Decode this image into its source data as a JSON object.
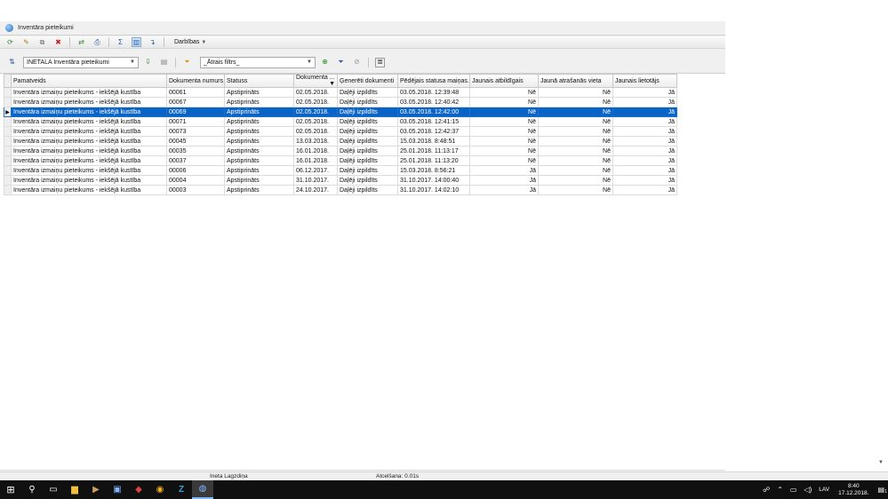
{
  "window": {
    "title": "Inventāra pieteikumi"
  },
  "toolbar": {
    "actions_menu": "Darbības",
    "buttons": [
      {
        "name": "new-icon",
        "glyph": "⟳",
        "color": "#2a8a2a"
      },
      {
        "name": "edit-icon",
        "glyph": "✎",
        "color": "#b07a10"
      },
      {
        "name": "copy-icon",
        "glyph": "⧉",
        "color": "#666666"
      },
      {
        "name": "delete-icon",
        "glyph": "✖",
        "color": "#c82020"
      },
      {
        "name": "refresh-icon",
        "glyph": "⇄",
        "color": "#2a8a2a"
      },
      {
        "name": "print-icon",
        "glyph": "⎙",
        "color": "#2a5aa0"
      },
      {
        "name": "sum-icon",
        "glyph": "Σ",
        "color": "#2a5aa0"
      },
      {
        "name": "columns-icon",
        "glyph": "▥",
        "color": "#2a5aa0"
      },
      {
        "name": "export-icon",
        "glyph": "↴",
        "color": "#2a5aa0"
      }
    ]
  },
  "filter": {
    "view_value": "INETALA Inventāra pieteikumi",
    "quick_filter_value": "_Ātrais filtrs_"
  },
  "grid": {
    "columns": [
      "Pamatveids",
      "Dokumenta numurs",
      "Statuss",
      "Dokumenta ...",
      "Ģenerēti dokumenti",
      "Pēdējais statusa maiņas...",
      "Jaunais atbildīgais",
      "Jaunā atrašanās vieta",
      "Jaunais lietotājs"
    ],
    "selected_index": 2,
    "rows": [
      [
        "Inventāra izmaiņu pieteikums - iekšējā kustība",
        "00061",
        "Apstiprināts",
        "02.05.2018.",
        "Daļēji izpildīts",
        "03.05.2018. 12:39:48",
        "Nē",
        "Nē",
        "Jā"
      ],
      [
        "Inventāra izmaiņu pieteikums - iekšējā kustība",
        "00067",
        "Apstiprināts",
        "02.05.2018.",
        "Daļēji izpildīts",
        "03.05.2018. 12:40:42",
        "Nē",
        "Nē",
        "Jā"
      ],
      [
        "Inventāra izmaiņu pieteikums - iekšējā kustība",
        "00069",
        "Apstiprināts",
        "02.05.2018.",
        "Daļēji izpildīts",
        "03.05.2018. 12:42:00",
        "Nē",
        "Nē",
        "Jā"
      ],
      [
        "Inventāra izmaiņu pieteikums - iekšējā kustība",
        "00071",
        "Apstiprināts",
        "02.05.2018.",
        "Daļēji izpildīts",
        "03.05.2018. 12:41:15",
        "Nē",
        "Nē",
        "Jā"
      ],
      [
        "Inventāra izmaiņu pieteikums - iekšējā kustība",
        "00073",
        "Apstiprināts",
        "02.05.2018.",
        "Daļēji izpildīts",
        "03.05.2018. 12:42:37",
        "Nē",
        "Nē",
        "Jā"
      ],
      [
        "Inventāra izmaiņu pieteikums - iekšējā kustība",
        "00045",
        "Apstiprināts",
        "13.03.2018.",
        "Daļēji izpildīts",
        "15.03.2018. 8:48:51",
        "Nē",
        "Nē",
        "Jā"
      ],
      [
        "Inventāra izmaiņu pieteikums - iekšējā kustība",
        "00035",
        "Apstiprināts",
        "16.01.2018.",
        "Daļēji izpildīts",
        "25.01.2018. 11:13:17",
        "Nē",
        "Nē",
        "Jā"
      ],
      [
        "Inventāra izmaiņu pieteikums - iekšējā kustība",
        "00037",
        "Apstiprināts",
        "16.01.2018.",
        "Daļēji izpildīts",
        "25.01.2018. 11:13:20",
        "Nē",
        "Nē",
        "Jā"
      ],
      [
        "Inventāra izmaiņu pieteikums - iekšējā kustība",
        "00006",
        "Apstiprināts",
        "06.12.2017.",
        "Daļēji izpildīts",
        "15.03.2018. 8:56:21",
        "Jā",
        "Nē",
        "Jā"
      ],
      [
        "Inventāra izmaiņu pieteikums - iekšējā kustība",
        "00004",
        "Apstiprināts",
        "31.10.2017.",
        "Daļēji izpildīts",
        "31.10.2017. 14:00:40",
        "Jā",
        "Nē",
        "Jā"
      ],
      [
        "Inventāra izmaiņu pieteikums - iekšējā kustība",
        "00003",
        "Apstiprināts",
        "24.10.2017.",
        "Daļēji izpildīts",
        "31.10.2017. 14:02:10",
        "Jā",
        "Nē",
        "Jā"
      ]
    ]
  },
  "status": {
    "user": "Ineta Lagzdiņa",
    "refresh": "Atcelšana: 0.01s"
  },
  "taskbar": {
    "language": "LAV",
    "time": "8:40",
    "date": "17.12.2018.",
    "notifications": "1"
  }
}
